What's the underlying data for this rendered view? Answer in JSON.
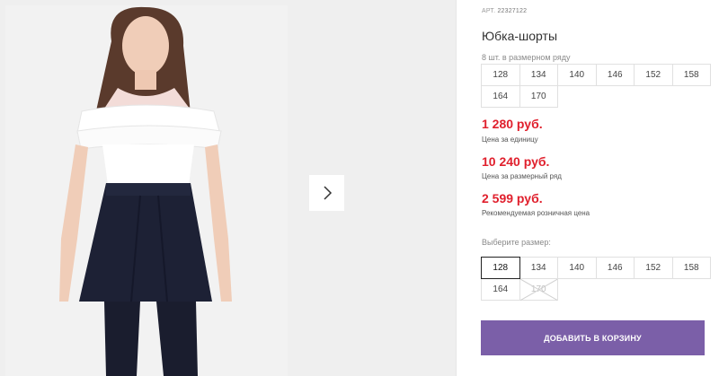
{
  "gallery": {
    "next_icon": "chevron-right-icon"
  },
  "product": {
    "article_prefix": "АРТ.",
    "article_number": "22327122",
    "title": "Юбка-шорты",
    "pack_label": "8 шт. в размерном ряду",
    "pack_sizes": [
      "128",
      "134",
      "140",
      "146",
      "152",
      "158",
      "164",
      "170"
    ]
  },
  "prices": [
    {
      "value": "1 280 руб.",
      "label": "Цена за единицу"
    },
    {
      "value": "10 240 руб.",
      "label": "Цена за размерный ряд"
    },
    {
      "value": "2 599 руб.",
      "label": "Рекомендуемая розничная цена"
    }
  ],
  "size_select": {
    "label": "Выберите размер:",
    "options": [
      {
        "size": "128",
        "state": "selected"
      },
      {
        "size": "134",
        "state": "available"
      },
      {
        "size": "140",
        "state": "available"
      },
      {
        "size": "146",
        "state": "available"
      },
      {
        "size": "152",
        "state": "available"
      },
      {
        "size": "158",
        "state": "available"
      },
      {
        "size": "164",
        "state": "available"
      },
      {
        "size": "170",
        "state": "disabled"
      }
    ]
  },
  "cart": {
    "add_label": "ДОБАВИТЬ В КОРЗИНУ"
  },
  "colors": {
    "price": "#e0202d",
    "button": "#7b5fa8"
  }
}
